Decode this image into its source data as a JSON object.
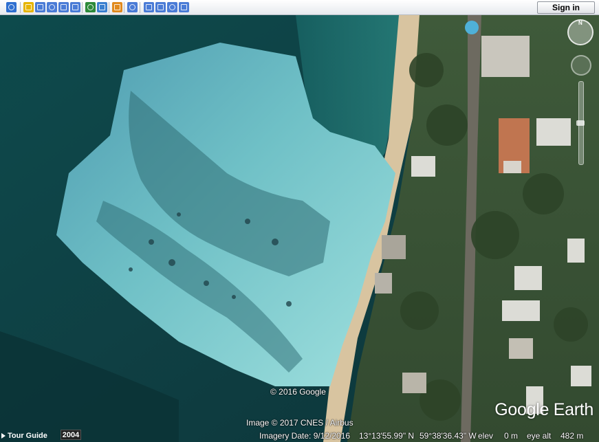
{
  "toolbar": {
    "buttons": [
      {
        "icon": "sidebar-toggle-icon",
        "color": "#2f6fd0"
      },
      {
        "icon": "add-placemark-icon",
        "color": "#e6b400"
      },
      {
        "icon": "add-polygon-icon",
        "color": "#4a7bd6"
      },
      {
        "icon": "add-path-icon",
        "color": "#4a7bd6"
      },
      {
        "icon": "add-overlay-icon",
        "color": "#4a7bd6"
      },
      {
        "icon": "record-tour-icon",
        "color": "#4a7bd6"
      },
      {
        "icon": "historical-imagery-icon",
        "color": "#2d8a3a"
      },
      {
        "icon": "sunlight-icon",
        "color": "#3a7fcf"
      },
      {
        "icon": "planets-icon",
        "color": "#e08a1e"
      },
      {
        "icon": "ruler-icon",
        "color": "#4a7bd6"
      },
      {
        "icon": "email-icon",
        "color": "#4a7bd6"
      },
      {
        "icon": "print-icon",
        "color": "#4a7bd6"
      },
      {
        "icon": "save-image-icon",
        "color": "#4a7bd6"
      },
      {
        "icon": "view-in-maps-icon",
        "color": "#4a7bd6"
      }
    ],
    "sign_in_label": "Sign in"
  },
  "map": {
    "copyright_google": "© 2016 Google",
    "image_credit": "Image © 2017 CNES / Airbus",
    "logo": "Google Earth"
  },
  "status_bar": {
    "tour_guide_label": "Tour Guide",
    "year": "2004",
    "imagery_date": "Imagery Date: 9/12/2016",
    "latitude": "13°13'55.99\" N",
    "longitude": "59°38'36.43\" W",
    "elev_label": "elev",
    "elev_value": "0 m",
    "eye_alt_label": "eye alt",
    "eye_alt_value": "482 m"
  }
}
